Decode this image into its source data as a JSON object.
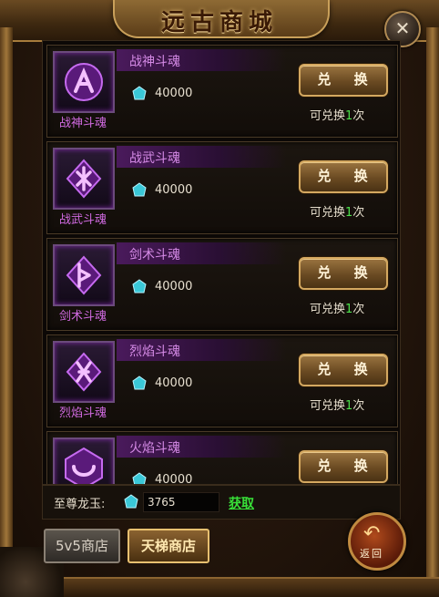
{
  "window": {
    "title": "远古商城",
    "close_symbol": "✕"
  },
  "items": [
    {
      "name": "战神斗魂",
      "icon_label": "战神斗魂",
      "rune_icon": "rune-a-icon",
      "price": "40000",
      "button": "兑 换",
      "limit_prefix": "可兑换",
      "limit_count": "1",
      "limit_suffix": "次"
    },
    {
      "name": "战武斗魂",
      "icon_label": "战武斗魂",
      "rune_icon": "rune-diamond-x-icon",
      "price": "40000",
      "button": "兑 换",
      "limit_prefix": "可兑换",
      "limit_count": "1",
      "limit_suffix": "次"
    },
    {
      "name": "剑术斗魂",
      "icon_label": "剑术斗魂",
      "rune_icon": "rune-flag-icon",
      "price": "40000",
      "button": "兑 换",
      "limit_prefix": "可兑换",
      "limit_count": "1",
      "limit_suffix": "次"
    },
    {
      "name": "烈焰斗魂",
      "icon_label": "烈焰斗魂",
      "rune_icon": "rune-x-icon",
      "price": "40000",
      "button": "兑 换",
      "limit_prefix": "可兑换",
      "limit_count": "1",
      "limit_suffix": "次"
    },
    {
      "name": "火焰斗魂",
      "icon_label": "",
      "rune_icon": "rune-crescent-icon",
      "price": "40000",
      "button": "兑 换",
      "limit_prefix": "",
      "limit_count": "",
      "limit_suffix": ""
    }
  ],
  "currency": {
    "label": "至尊龙玉:",
    "amount": "3765",
    "get_link": "获取"
  },
  "tabs": [
    {
      "label": "5v5商店",
      "active": false
    },
    {
      "label": "天梯商店",
      "active": true
    }
  ],
  "back": {
    "label": "返回",
    "symbol": "↶"
  },
  "colors": {
    "gold": "#c9a05a",
    "purple": "#d06ae0",
    "green": "#4ce04c"
  }
}
